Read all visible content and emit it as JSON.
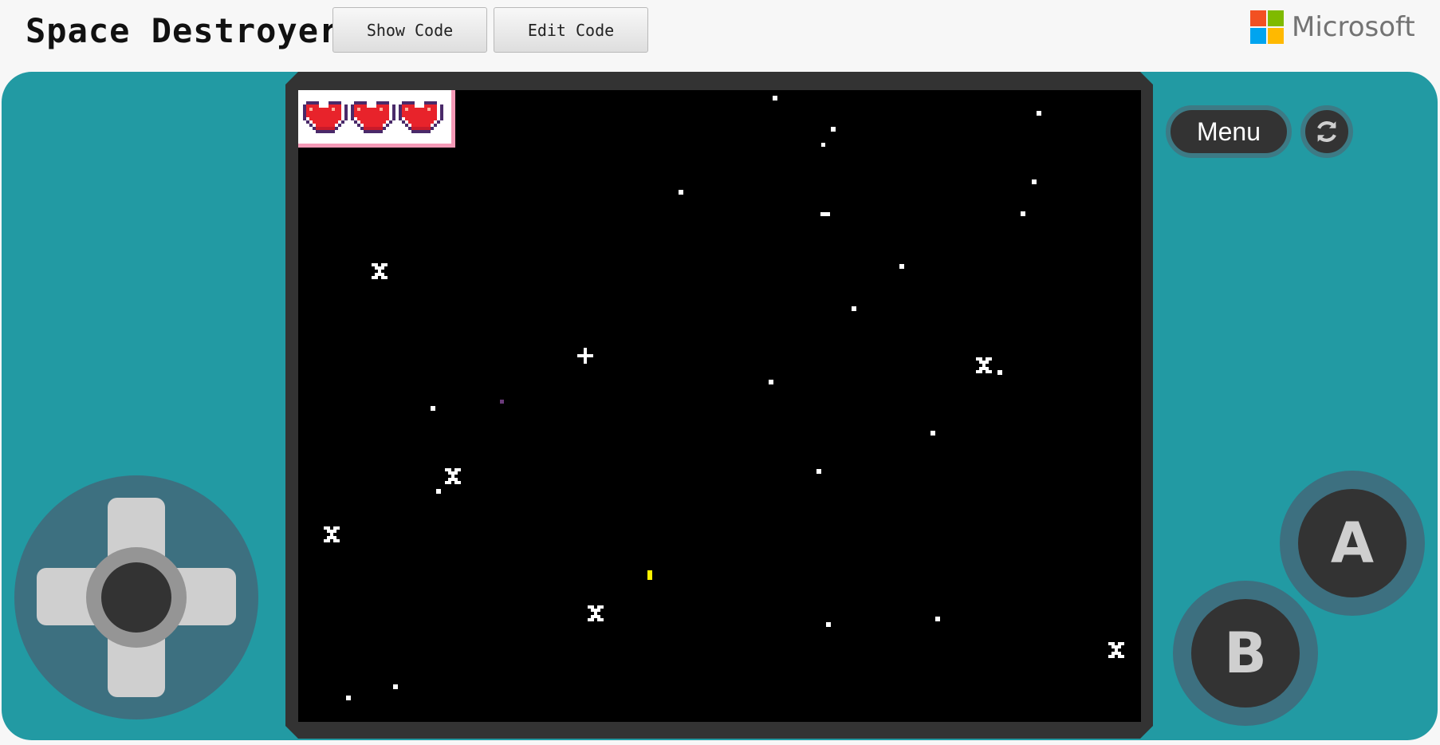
{
  "header": {
    "title": "Space Destroyer",
    "show_code_label": "Show Code",
    "edit_code_label": "Edit Code",
    "brand": "Microsoft"
  },
  "colors": {
    "console": "#229aa3",
    "bezel": "#333333",
    "screen": "#000000",
    "heart": "#e8232b",
    "ms_red": "#f25022",
    "ms_green": "#7fba00",
    "ms_blue": "#00a4ef",
    "ms_yellow": "#ffb900"
  },
  "game": {
    "lives": 3,
    "lives_icon": "heart-icon"
  },
  "controls": {
    "menu_label": "Menu",
    "reload_icon": "refresh-icon",
    "a_label": "A",
    "b_label": "B",
    "dpad_icon": "dpad-icon"
  }
}
